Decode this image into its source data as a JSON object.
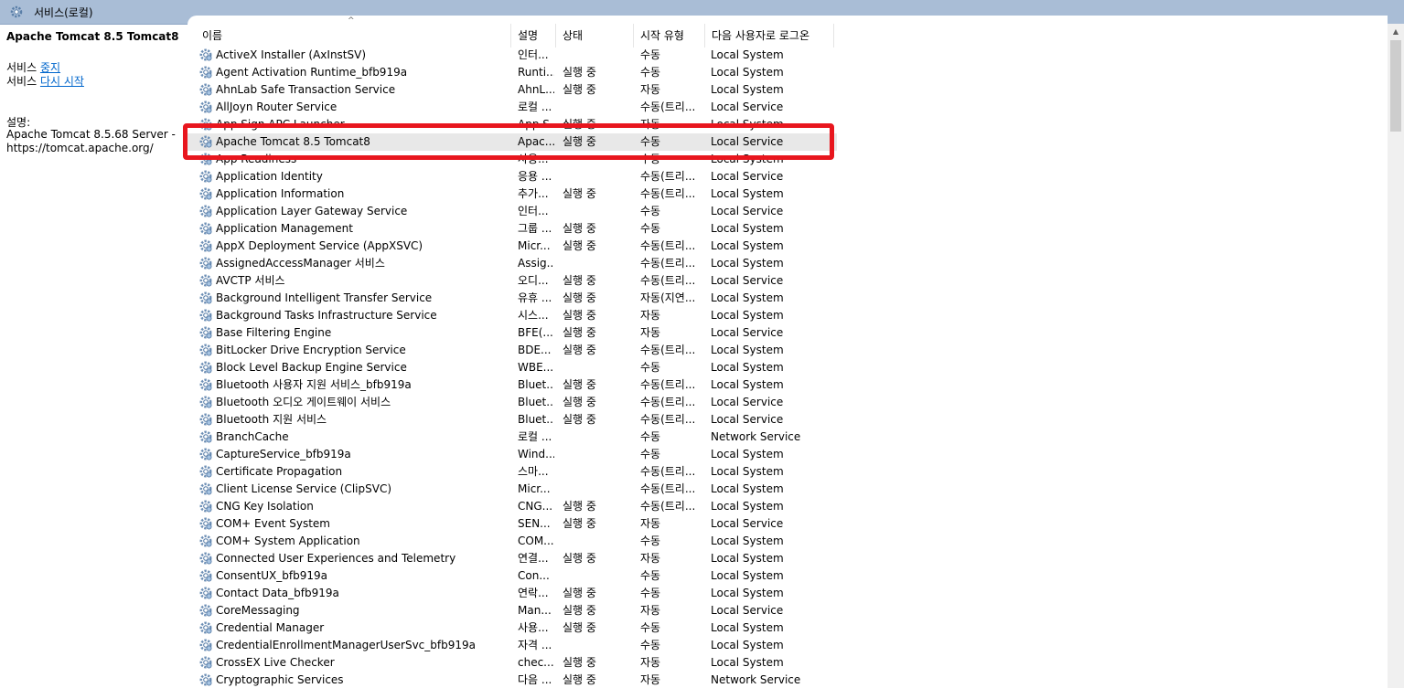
{
  "window": {
    "title": "서비스(로컬)"
  },
  "left_panel": {
    "service_name": "Apache Tomcat 8.5 Tomcat8",
    "actions": [
      {
        "prefix": "서비스 ",
        "link": "중지"
      },
      {
        "prefix": "서비스 ",
        "link": "다시 시작"
      }
    ],
    "description_label": "설명:",
    "description_text": "Apache Tomcat 8.5.68 Server - https://tomcat.apache.org/"
  },
  "columns": [
    "이름",
    "설명",
    "상태",
    "시작 유형",
    "다음 사용자로 로그온"
  ],
  "services": [
    {
      "name": "ActiveX Installer (AxInstSV)",
      "desc": "인터...",
      "status": "",
      "startup": "수동",
      "logon": "Local System"
    },
    {
      "name": "Agent Activation Runtime_bfb919a",
      "desc": "Runti...",
      "status": "실행 중",
      "startup": "수동",
      "logon": "Local System"
    },
    {
      "name": "AhnLab Safe Transaction Service",
      "desc": "AhnL...",
      "status": "실행 중",
      "startup": "자동",
      "logon": "Local System"
    },
    {
      "name": "AllJoyn Router Service",
      "desc": "로컬 ...",
      "status": "",
      "startup": "수동(트리...",
      "logon": "Local Service"
    },
    {
      "name": "App Sign APC Launcher",
      "desc": "App S...",
      "status": "실행 중",
      "startup": "자동",
      "logon": "Local System"
    },
    {
      "name": "Apache Tomcat 8.5 Tomcat8",
      "desc": "Apac...",
      "status": "실행 중",
      "startup": "수동",
      "logon": "Local Service",
      "selected": true
    },
    {
      "name": "App Readiness",
      "desc": "사용...",
      "status": "",
      "startup": "수동",
      "logon": "Local System"
    },
    {
      "name": "Application Identity",
      "desc": "응용 ...",
      "status": "",
      "startup": "수동(트리...",
      "logon": "Local Service"
    },
    {
      "name": "Application Information",
      "desc": "추가...",
      "status": "실행 중",
      "startup": "수동(트리...",
      "logon": "Local System"
    },
    {
      "name": "Application Layer Gateway Service",
      "desc": "인터...",
      "status": "",
      "startup": "수동",
      "logon": "Local Service"
    },
    {
      "name": "Application Management",
      "desc": "그룹 ...",
      "status": "실행 중",
      "startup": "수동",
      "logon": "Local System"
    },
    {
      "name": "AppX Deployment Service (AppXSVC)",
      "desc": "Micr...",
      "status": "실행 중",
      "startup": "수동(트리...",
      "logon": "Local System"
    },
    {
      "name": "AssignedAccessManager 서비스",
      "desc": "Assig...",
      "status": "",
      "startup": "수동(트리...",
      "logon": "Local System"
    },
    {
      "name": "AVCTP 서비스",
      "desc": "오디...",
      "status": "실행 중",
      "startup": "수동(트리...",
      "logon": "Local Service"
    },
    {
      "name": "Background Intelligent Transfer Service",
      "desc": "유휴 ...",
      "status": "실행 중",
      "startup": "자동(지연...",
      "logon": "Local System"
    },
    {
      "name": "Background Tasks Infrastructure Service",
      "desc": "시스...",
      "status": "실행 중",
      "startup": "자동",
      "logon": "Local System"
    },
    {
      "name": "Base Filtering Engine",
      "desc": "BFE(...",
      "status": "실행 중",
      "startup": "자동",
      "logon": "Local Service"
    },
    {
      "name": "BitLocker Drive Encryption Service",
      "desc": "BDE...",
      "status": "실행 중",
      "startup": "수동(트리...",
      "logon": "Local System"
    },
    {
      "name": "Block Level Backup Engine Service",
      "desc": "WBE...",
      "status": "",
      "startup": "수동",
      "logon": "Local System"
    },
    {
      "name": "Bluetooth 사용자 지원 서비스_bfb919a",
      "desc": "Bluet...",
      "status": "실행 중",
      "startup": "수동(트리...",
      "logon": "Local System"
    },
    {
      "name": "Bluetooth 오디오 게이트웨이 서비스",
      "desc": "Bluet...",
      "status": "실행 중",
      "startup": "수동(트리...",
      "logon": "Local Service"
    },
    {
      "name": "Bluetooth 지원 서비스",
      "desc": "Bluet...",
      "status": "실행 중",
      "startup": "수동(트리...",
      "logon": "Local Service"
    },
    {
      "name": "BranchCache",
      "desc": "로컬 ...",
      "status": "",
      "startup": "수동",
      "logon": "Network Service"
    },
    {
      "name": "CaptureService_bfb919a",
      "desc": "Wind...",
      "status": "",
      "startup": "수동",
      "logon": "Local System"
    },
    {
      "name": "Certificate Propagation",
      "desc": "스마...",
      "status": "",
      "startup": "수동(트리...",
      "logon": "Local System"
    },
    {
      "name": "Client License Service (ClipSVC)",
      "desc": "Micr...",
      "status": "",
      "startup": "수동(트리...",
      "logon": "Local System"
    },
    {
      "name": "CNG Key Isolation",
      "desc": "CNG...",
      "status": "실행 중",
      "startup": "수동(트리...",
      "logon": "Local System"
    },
    {
      "name": "COM+ Event System",
      "desc": "SEN...",
      "status": "실행 중",
      "startup": "자동",
      "logon": "Local Service"
    },
    {
      "name": "COM+ System Application",
      "desc": "COM...",
      "status": "",
      "startup": "수동",
      "logon": "Local System"
    },
    {
      "name": "Connected User Experiences and Telemetry",
      "desc": "연결...",
      "status": "실행 중",
      "startup": "자동",
      "logon": "Local System"
    },
    {
      "name": "ConsentUX_bfb919a",
      "desc": "Con...",
      "status": "",
      "startup": "수동",
      "logon": "Local System"
    },
    {
      "name": "Contact Data_bfb919a",
      "desc": "연락...",
      "status": "실행 중",
      "startup": "수동",
      "logon": "Local System"
    },
    {
      "name": "CoreMessaging",
      "desc": "Man...",
      "status": "실행 중",
      "startup": "자동",
      "logon": "Local Service"
    },
    {
      "name": "Credential Manager",
      "desc": "사용...",
      "status": "실행 중",
      "startup": "수동",
      "logon": "Local System"
    },
    {
      "name": "CredentialEnrollmentManagerUserSvc_bfb919a",
      "desc": "자격 ...",
      "status": "",
      "startup": "수동",
      "logon": "Local System"
    },
    {
      "name": "CrossEX Live Checker",
      "desc": "chec...",
      "status": "실행 중",
      "startup": "자동",
      "logon": "Local System"
    },
    {
      "name": "Cryptographic Services",
      "desc": "다음 ...",
      "status": "실행 중",
      "startup": "자동",
      "logon": "Network Service"
    }
  ],
  "icons": {
    "title": "gear-icon",
    "service": "gear-icon"
  },
  "colors": {
    "highlight": "#e8161e",
    "link": "#0066cc",
    "titlebar": "#a9bdd6"
  }
}
